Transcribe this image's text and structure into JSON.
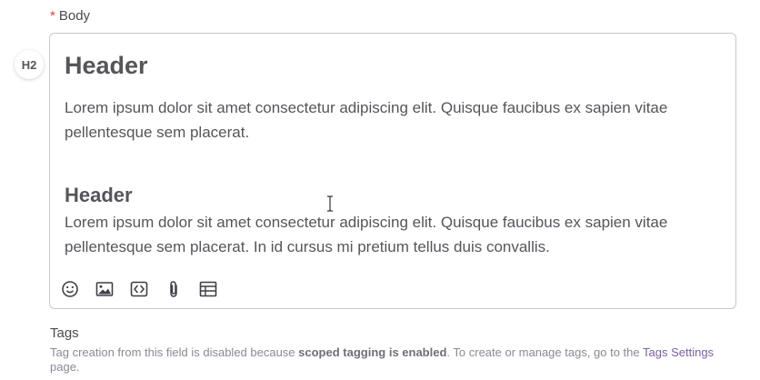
{
  "body_field": {
    "required_mark": "*",
    "label": "Body",
    "heading_badge": "H2"
  },
  "editor": {
    "heading_1": "Header",
    "paragraph_1": "Lorem ipsum dolor sit amet consectetur adipiscing elit. Quisque faucibus ex sapien vitae pellentesque sem placerat.",
    "heading_2": "Header",
    "paragraph_2": "Lorem ipsum dolor sit amet consectetur adipiscing elit. Quisque faucibus ex sapien vitae pellentesque sem placerat. In id cursus mi pretium tellus duis convallis.",
    "toolbar_icons": [
      "emoji-icon",
      "image-icon",
      "code-icon",
      "attachment-icon",
      "table-icon"
    ]
  },
  "tags_field": {
    "label": "Tags",
    "help_prefix": "Tag creation from this field is disabled because ",
    "help_bold": "scoped tagging is enabled",
    "help_middle": ". To create or manage tags, go to the ",
    "help_link": "Tags Settings",
    "help_suffix": " page."
  },
  "colors": {
    "required": "#d64545",
    "link": "#7a5fa8",
    "border": "#c9c9cf"
  }
}
